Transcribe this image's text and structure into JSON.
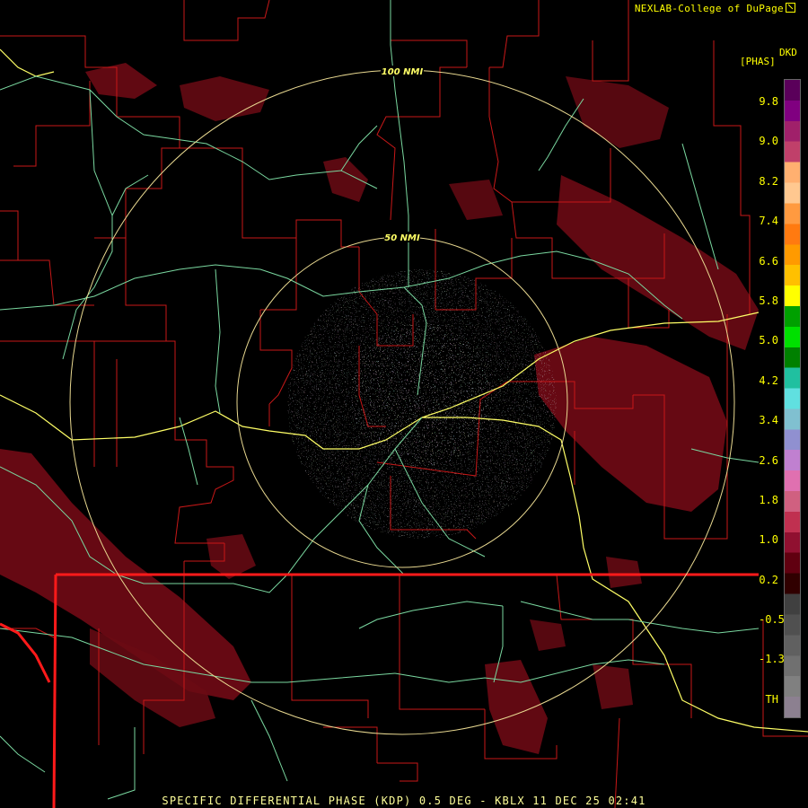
{
  "header": {
    "credit": "NEXLAB-College of DuPage",
    "credit_icon": "external-link-icon",
    "units": "[PHAS]",
    "product_code": "DKD"
  },
  "rings": [
    {
      "label": "100 NMI"
    },
    {
      "label": "50 NMI"
    }
  ],
  "legend": {
    "ticks": [
      "9.8",
      "9.0",
      "8.2",
      "7.4",
      "6.6",
      "5.8",
      "5.0",
      "4.2",
      "3.4",
      "2.6",
      "1.8",
      "1.0",
      "0.2",
      "-0.5",
      "-1.3",
      "TH"
    ],
    "colors": [
      "#5a005a",
      "#800080",
      "#a0206a",
      "#c0406a",
      "#ffb070",
      "#ffc890",
      "#ff9a40",
      "#ff7a10",
      "#ff9a00",
      "#ffc000",
      "#ffff00",
      "#00a000",
      "#00e000",
      "#008000",
      "#20c0a0",
      "#60e0e0",
      "#80c0d0",
      "#9090d0",
      "#c080d0",
      "#e070b0",
      "#d06080",
      "#c03050",
      "#901030",
      "#600010",
      "#300000",
      "#404040",
      "#505050",
      "#606060",
      "#707070",
      "#808080",
      "#8c8090"
    ]
  },
  "caption": "SPECIFIC DIFFERENTIAL PHASE (KDP) 0.5 DEG - KBLX 11 DEC 25 02:41"
}
